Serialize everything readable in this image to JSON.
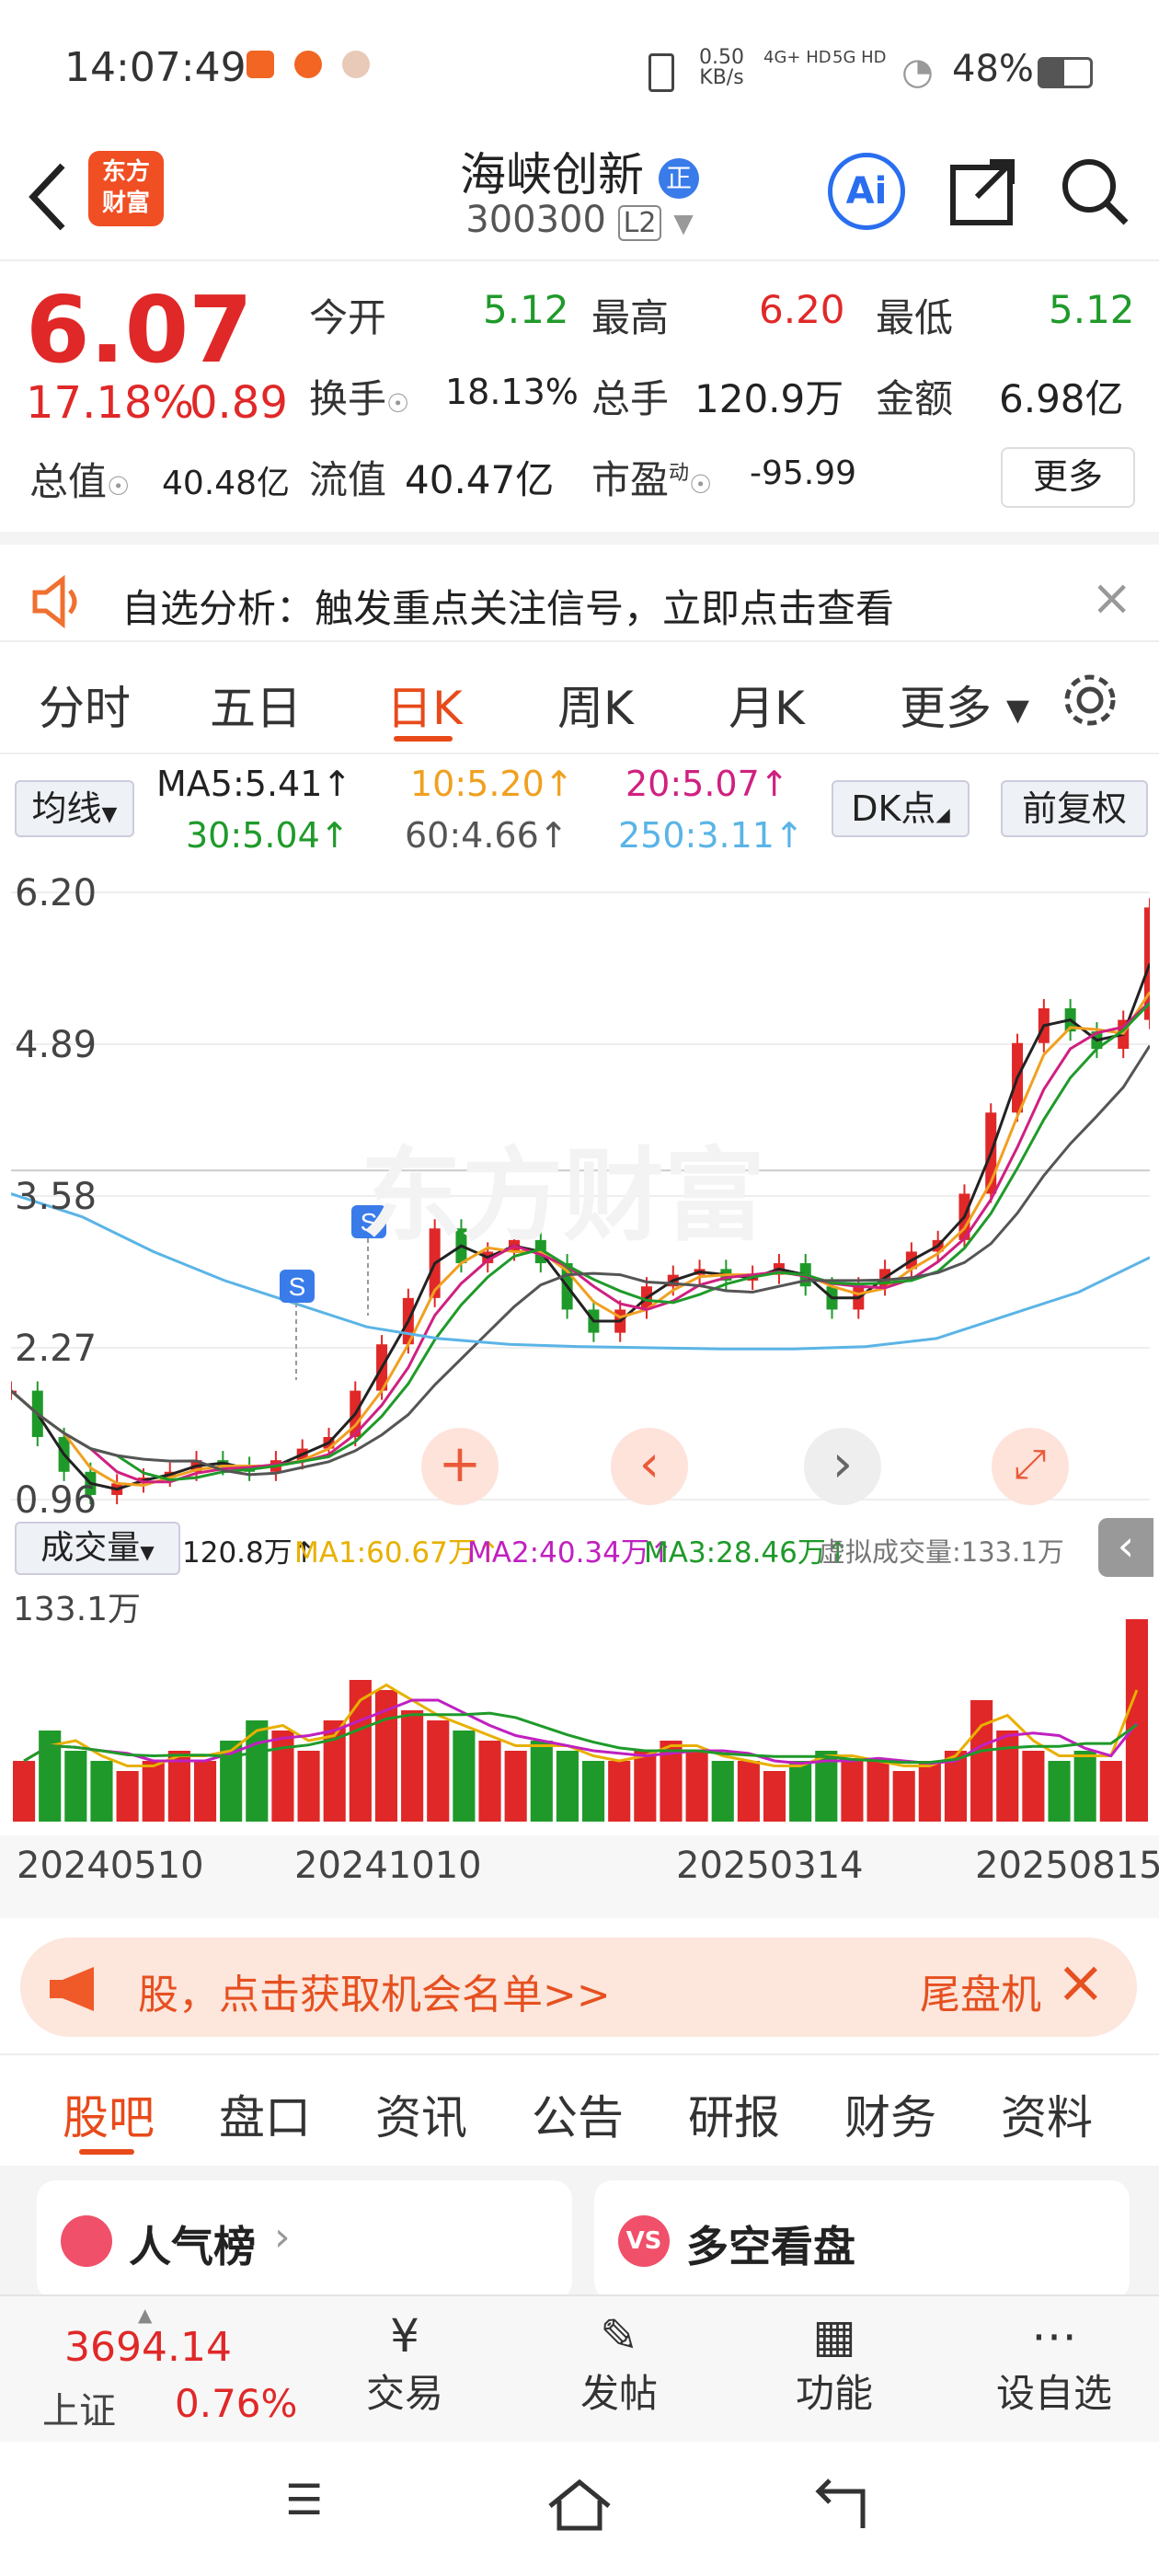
{
  "status_bar": {
    "time": "14:07:49",
    "net_speed": "0.50",
    "net_unit": "KB/s",
    "net1": "4G+ HD",
    "net2": "5G HD",
    "battery": "48%"
  },
  "header": {
    "logo_line1": "东方",
    "logo_line2": "财富",
    "stock_name": "海峡创新",
    "badge": "正",
    "stock_code": "300300",
    "level": "L2",
    "ai_label": "Ai"
  },
  "quote": {
    "price": "6.07",
    "change_pct": "17.18%",
    "change": "0.89",
    "open_label": "今开",
    "open": "5.12",
    "high_label": "最高",
    "high": "6.20",
    "low_label": "最低",
    "low": "5.12",
    "turnover_label": "换手",
    "turnover": "18.13%",
    "volume_label": "总手",
    "volume": "120.9万",
    "amount_label": "金额",
    "amount": "6.98亿",
    "mktcap_label": "总值",
    "mktcap": "40.48亿",
    "float_label": "流值",
    "float": "40.47亿",
    "pe_label": "市盈",
    "pe_sup": "动",
    "pe": "-95.99",
    "more_label": "更多"
  },
  "notice": {
    "text": "自选分析：触发重点关注信号，立即点击查看"
  },
  "tabs": [
    "分时",
    "五日",
    "日K",
    "周K",
    "月K",
    "更多"
  ],
  "active_tab": "日K",
  "ma": {
    "selector": "均线",
    "ma5": "MA5:5.41↑",
    "ma10": "10:5.20↑",
    "ma20": "20:5.07↑",
    "ma30": "30:5.04↑",
    "ma60": "60:4.66↑",
    "ma250": "250:3.11↑",
    "dk": "DK点",
    "adj": "前复权",
    "colors": {
      "ma5": "#222222",
      "ma10": "#f0a020",
      "ma20": "#d02080",
      "ma30": "#1f9a2a",
      "ma60": "#555555",
      "ma250": "#5ab4e6"
    }
  },
  "chart_data": {
    "type": "candlestick",
    "y_ticks": [
      "6.20",
      "4.89",
      "3.58",
      "2.27",
      "0.96"
    ],
    "ylim": [
      0.96,
      6.2
    ],
    "x_ticks": [
      "20240510",
      "20241010",
      "20250314",
      "20250815"
    ],
    "watermark": "东方财富",
    "signal_label": "S",
    "close_approx": [
      1.9,
      1.5,
      1.2,
      1.0,
      1.1,
      1.15,
      1.2,
      1.3,
      1.25,
      1.2,
      1.3,
      1.4,
      1.5,
      1.9,
      2.3,
      2.7,
      3.3,
      3.0,
      3.1,
      3.2,
      3.0,
      2.6,
      2.4,
      2.6,
      2.8,
      2.9,
      2.95,
      2.85,
      2.9,
      3.0,
      2.8,
      2.6,
      2.8,
      2.95,
      3.1,
      3.2,
      3.6,
      4.3,
      4.9,
      5.2,
      5.0,
      4.85,
      5.1,
      6.07
    ],
    "ma250_approx": [
      3.6,
      3.4,
      3.1,
      2.85,
      2.65,
      2.45,
      2.35,
      2.3,
      2.28,
      2.27,
      2.26,
      2.26,
      2.28,
      2.35,
      2.55,
      2.75,
      3.05
    ]
  },
  "volume": {
    "selector": "成交量",
    "vol": "120.8万↑",
    "ma1": "MA1:60.67万↑",
    "ma2": "MA2:40.34万↑",
    "ma3": "MA3:28.46万↑",
    "virtual": "虚拟成交量:133.1万",
    "max_label": "133.1万",
    "values": [
      0.3,
      0.45,
      0.35,
      0.3,
      0.25,
      0.3,
      0.35,
      0.3,
      0.4,
      0.5,
      0.45,
      0.35,
      0.5,
      0.7,
      0.65,
      0.55,
      0.5,
      0.45,
      0.4,
      0.35,
      0.4,
      0.35,
      0.3,
      0.3,
      0.35,
      0.4,
      0.35,
      0.3,
      0.3,
      0.25,
      0.3,
      0.35,
      0.3,
      0.3,
      0.25,
      0.3,
      0.35,
      0.6,
      0.45,
      0.35,
      0.3,
      0.35,
      0.3,
      1.0
    ]
  },
  "banner": {
    "text": "股，点击获取机会名单>>",
    "right": "尾盘机"
  },
  "bottom_tabs": [
    "股吧",
    "盘口",
    "资讯",
    "公告",
    "研报",
    "财务",
    "资料"
  ],
  "cards": [
    {
      "label": "人气榜"
    },
    {
      "label": "多空看盘"
    }
  ],
  "dock": {
    "index_value": "3694.14",
    "index_name": "上证",
    "index_change": "0.76%",
    "items": [
      "交易",
      "发帖",
      "功能",
      "设自选"
    ]
  }
}
